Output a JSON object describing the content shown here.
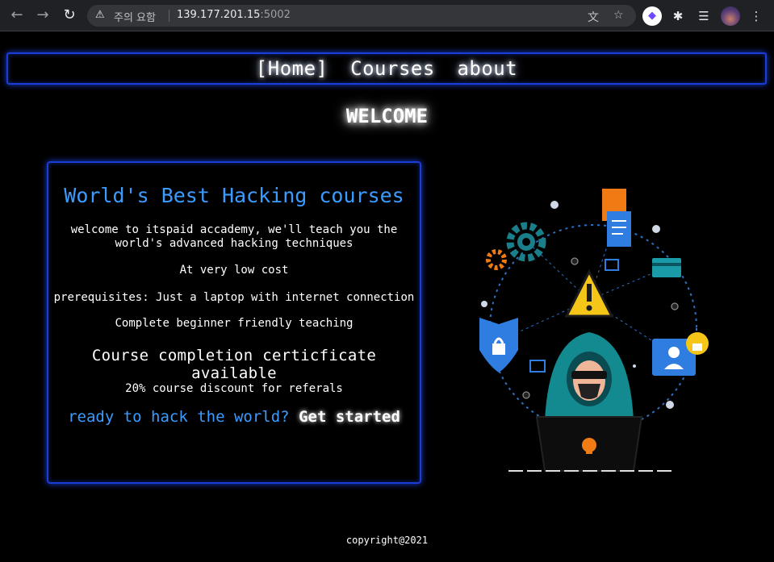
{
  "browser": {
    "security_label": "주의 요함",
    "url_host": "139.177.201.15",
    "url_port": ":5002"
  },
  "nav": {
    "items": [
      {
        "label": "[Home]"
      },
      {
        "label": "Courses"
      },
      {
        "label": "about"
      }
    ]
  },
  "page": {
    "welcome": "WELCOME"
  },
  "card": {
    "title": "World's Best Hacking courses",
    "intro": "welcome to itspaid accademy, we'll teach you the world's advanced hacking techniques",
    "cost": "At very low cost",
    "prereq": "prerequisites: Just a laptop with internet connection",
    "beginner": "Complete beginner friendly teaching",
    "certificate": "Course completion certicficate available",
    "discount": "20% course discount for referals",
    "cta_question": "ready to hack the world?",
    "cta_button": "Get started"
  },
  "footer": {
    "copyright": "copyright@2021"
  },
  "colors": {
    "accent_blue": "#3b9cff",
    "border_blue": "#1a3dd6",
    "background": "#000000"
  }
}
